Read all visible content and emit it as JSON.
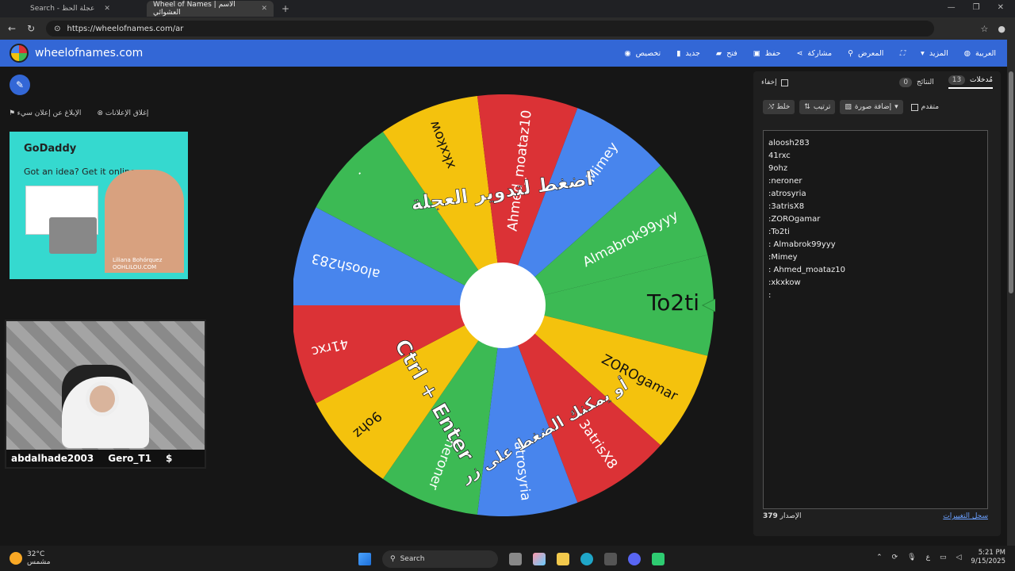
{
  "browser": {
    "tabs": [
      {
        "label": "Search - عجلة الحظ"
      },
      {
        "label": "Wheel of Names | الاسم العشوائي"
      }
    ],
    "url": "https://wheelofnames.com/ar"
  },
  "site": {
    "brand": "wheelofnames.com",
    "menu": [
      {
        "label": "تخصيص",
        "icon": "palette-icon"
      },
      {
        "label": "جديد",
        "icon": "file-icon"
      },
      {
        "label": "فتح",
        "icon": "folder-icon"
      },
      {
        "label": "حفظ",
        "icon": "save-icon"
      },
      {
        "label": "مشاركة",
        "icon": "share-icon"
      },
      {
        "label": "المعرض",
        "icon": "search-icon"
      },
      {
        "label": "",
        "icon": "fullscreen-icon"
      },
      {
        "label": "المزيد",
        "icon": "chevron-down-icon"
      },
      {
        "label": "العربية",
        "icon": "globe-icon"
      }
    ]
  },
  "left": {
    "close_ads": "إغلاق الإعلانات",
    "report_ad": "الإبلاغ عن إعلان سيء",
    "ad": {
      "brand": "GoDaddy",
      "tagline": "Got an idea? Get it online.",
      "credit_name": "Liliana Bohórquez",
      "credit_site": "OOHLILOU.COM"
    },
    "webcam": {
      "name1": "abdalhade2003",
      "name2": "Gero_T1",
      "symbol": "$"
    }
  },
  "wheel": {
    "center_text": "اضغط لتدوير العجلة",
    "hint_text": "أو يمكنك الضغط على زر",
    "shortcut": "Ctrl + Enter",
    "colors": [
      "#3cba54",
      "#f4c20d",
      "#db3236",
      "#4885ed"
    ],
    "segments": [
      "To2ti",
      "ZOROgamar",
      "3atrisX8",
      "atrosyria",
      "neroner",
      "9ohz",
      "41rxc",
      "aloosh283",
      ".",
      "xkxkow",
      "Ahmed_moataz10",
      "Mimey",
      "Almabrok99yyy"
    ]
  },
  "panel": {
    "tab_entries": "مُدخلات",
    "entries_count": "13",
    "tab_results": "النتائج",
    "results_count": "0",
    "hide": "إخفاء",
    "shuffle": "خلط",
    "sort": "ترتيب",
    "add_image": "إضافة صورة",
    "advanced": "متقدم",
    "entries": [
      "aloosh283",
      "41rxc",
      "9ohz",
      ":neroner",
      ":atrosyria",
      ":3atrisX8",
      ":ZOROgamar",
      ":To2ti",
      ": Almabrok99yyy",
      ":Mimey",
      ": Ahmed_moataz10",
      ":xkxkow",
      ":"
    ],
    "version_label": "الإصدار",
    "version": "379",
    "changelog": "سجل التغييرات"
  },
  "taskbar": {
    "temp": "32°C",
    "weather": "مشمس",
    "search": "Search",
    "time": "5:21 PM",
    "date": "9/15/2025",
    "lang": "ع"
  }
}
